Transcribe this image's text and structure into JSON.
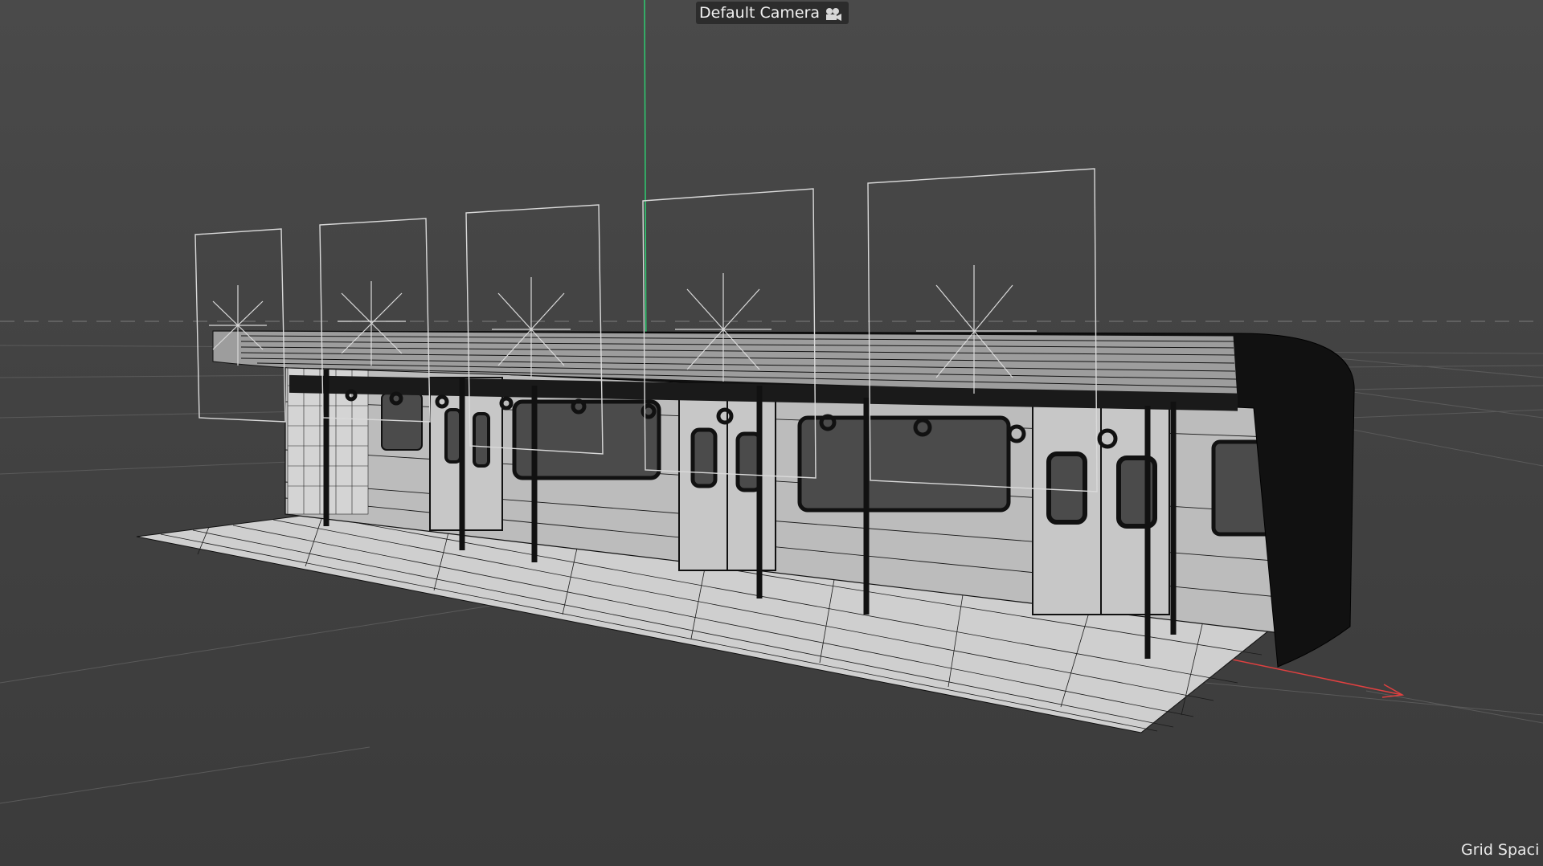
{
  "viewport": {
    "camera_label": "Default Camera",
    "camera_icon": "camera-icon",
    "grid_spacing_label": "Grid Spaci"
  },
  "colors": {
    "background": "#434343",
    "y_axis": "#2ecc71",
    "x_axis": "#e04040",
    "wireframe": "#000000",
    "surface": "#bdbdbd",
    "light_gizmo": "#d9d9d9"
  },
  "scene": {
    "object": "subway-car-interior",
    "light_count": 5,
    "door_count": 3
  }
}
